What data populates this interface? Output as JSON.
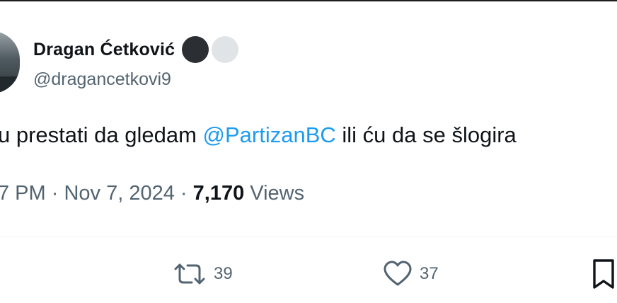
{
  "author": {
    "name": "Dragan Ćetković",
    "handle": "@dragancetkovi9"
  },
  "tweet": {
    "text_before": "u prestati da gledam ",
    "mention": "@PartizanBC",
    "text_after": " ili ću da se šlogira"
  },
  "meta": {
    "time": "7 PM",
    "sep1": " · ",
    "date": "Nov 7, 2024",
    "sep2": " · ",
    "views_count": "7,170",
    "views_label": " Views"
  },
  "actions": {
    "retweet": {
      "icon": "retweet-icon",
      "count": "39"
    },
    "like": {
      "icon": "heart-icon",
      "count": "37"
    },
    "bookmark": {
      "icon": "bookmark-icon"
    }
  },
  "colors": {
    "link": "#1d9bf0",
    "secondary_text": "#536471",
    "primary_text": "#0f1419"
  }
}
